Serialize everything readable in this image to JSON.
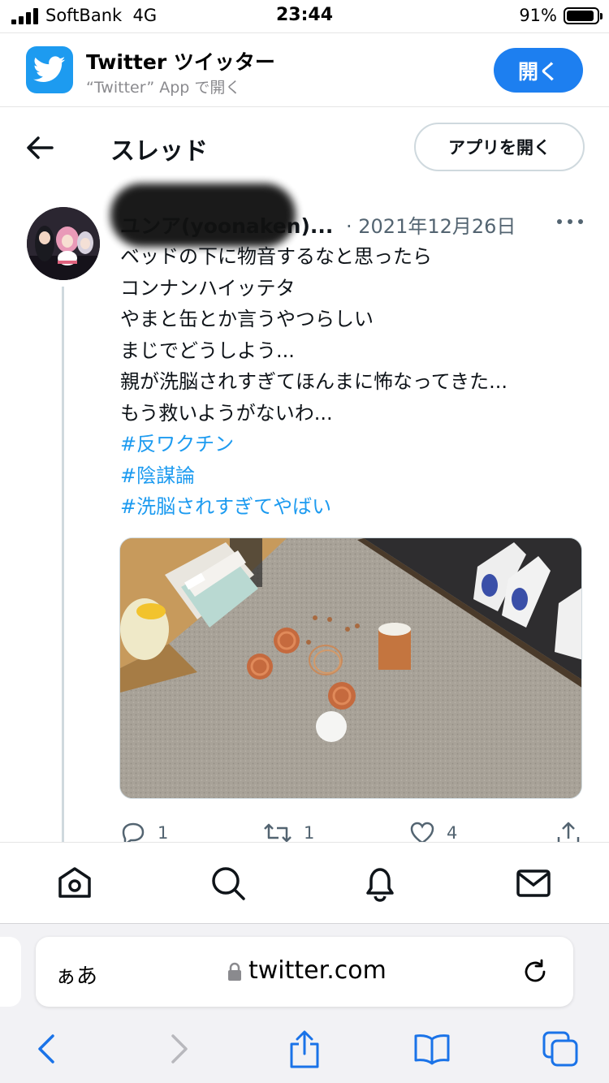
{
  "status_bar": {
    "carrier": "SoftBank",
    "network": "4G",
    "time": "23:44",
    "battery_percent_label": "91%",
    "battery_level": 0.91
  },
  "app_banner": {
    "app_name": "Twitter ツイッター",
    "subtitle": "“Twitter” App で開く",
    "open_label": "開く",
    "icon": "twitter-bird-icon"
  },
  "header": {
    "title": "スレッド",
    "open_app_label": "アプリを開く",
    "back_icon": "back-arrow-icon"
  },
  "tweet": {
    "author_name": "ユンア(yoonaken)...",
    "date": "· 2021年12月26日",
    "text_lines": [
      "ベッドの下に物音するなと思ったら",
      "コンナンハイッテタ",
      "やまと缶とか言うやつらしい",
      "まじでどうしよう...",
      "親が洗脳されすぎてほんまに怖なってきた...",
      "もう救いようがないわ..."
    ],
    "hashtags": [
      "#反ワクチン",
      "#陰謀論",
      "#洗脳されすぎてやばい"
    ],
    "stats": {
      "replies": "1",
      "retweets": "1",
      "likes": "4"
    }
  },
  "bottom_nav": {
    "items": [
      "home-icon",
      "search-icon",
      "notifications-icon",
      "messages-icon"
    ]
  },
  "safari": {
    "aa_label": "ぁあ",
    "url": "twitter.com",
    "toolbar": [
      "back-icon",
      "forward-icon",
      "share-icon",
      "bookmarks-icon",
      "tabs-icon"
    ]
  },
  "colors": {
    "twitter_blue": "#1d9bf0",
    "banner_button": "#1d7ff0",
    "safari_blue": "#1a73e8",
    "secondary_text": "#536471"
  }
}
